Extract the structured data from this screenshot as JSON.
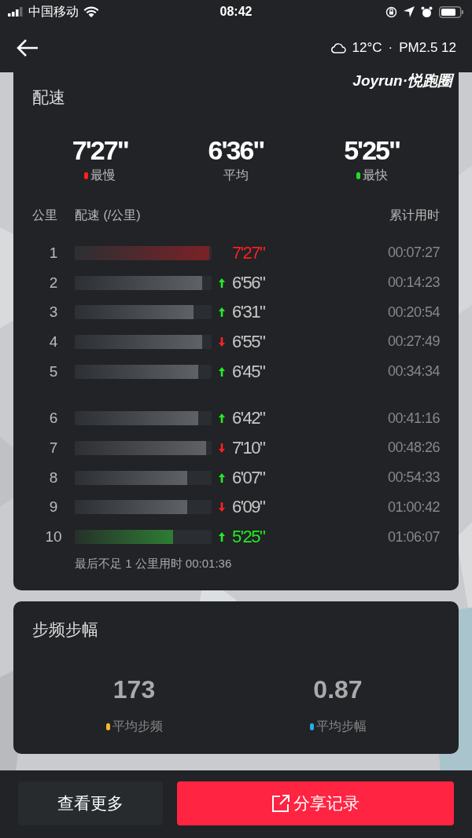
{
  "status_bar": {
    "carrier": "中国移动",
    "time": "08:42"
  },
  "header": {
    "weather": "12°C",
    "separator": "·",
    "air": "PM2.5 12",
    "brand": "Joyrun·悦跑圈"
  },
  "pace_card": {
    "title": "配速",
    "summary": [
      {
        "value": "7'27\"",
        "label": "最慢",
        "color": "#ff2020"
      },
      {
        "value": "6'36\"",
        "label": "平均"
      },
      {
        "value": "5'25\"",
        "label": "最快",
        "color": "#22dd22"
      }
    ],
    "columns": [
      "公里",
      "配速 (/公里)",
      "累计用时"
    ],
    "rows": [
      {
        "km": "1",
        "kind": "slowest",
        "level": 0.98,
        "pace": "7'27\"",
        "total": "00:07:27"
      },
      {
        "km": "2",
        "kind": "normal",
        "level": 0.93,
        "faster": true,
        "pace": "6'56\"",
        "total": "00:14:23"
      },
      {
        "km": "3",
        "kind": "normal",
        "level": 0.87,
        "faster": true,
        "pace": "6'31\"",
        "total": "00:20:54"
      },
      {
        "km": "4",
        "kind": "normal",
        "level": 0.93,
        "faster": false,
        "pace": "6'55\"",
        "total": "00:27:49"
      },
      {
        "km": "5",
        "kind": "normal",
        "level": 0.9,
        "faster": true,
        "pace": "6'45\"",
        "total": "00:34:34"
      },
      {
        "km": "6",
        "kind": "normal",
        "level": 0.9,
        "faster": true,
        "pace": "6'42\"",
        "total": "00:41:16"
      },
      {
        "km": "7",
        "kind": "normal",
        "level": 0.96,
        "faster": false,
        "pace": "7'10\"",
        "total": "00:48:26"
      },
      {
        "km": "8",
        "kind": "normal",
        "level": 0.82,
        "faster": true,
        "pace": "6'07\"",
        "total": "00:54:33"
      },
      {
        "km": "9",
        "kind": "normal",
        "level": 0.82,
        "faster": false,
        "pace": "6'09\"",
        "total": "01:00:42"
      },
      {
        "km": "10",
        "kind": "fastest",
        "level": 0.72,
        "faster": true,
        "pace": "5'25\"",
        "total": "01:06:07"
      }
    ],
    "footnote": "最后不足 1 公里用时 00:01:36"
  },
  "cadence_card": {
    "title": "步频步幅",
    "stats": [
      {
        "value": "173",
        "label": "平均步频",
        "color": "#f5b82e"
      },
      {
        "value": "0.87",
        "label": "平均步幅",
        "color": "#22aee8"
      }
    ]
  },
  "buttons": [
    {
      "label": "查看更多",
      "kind": "secondary"
    },
    {
      "label": "分享记录",
      "kind": "primary"
    }
  ]
}
